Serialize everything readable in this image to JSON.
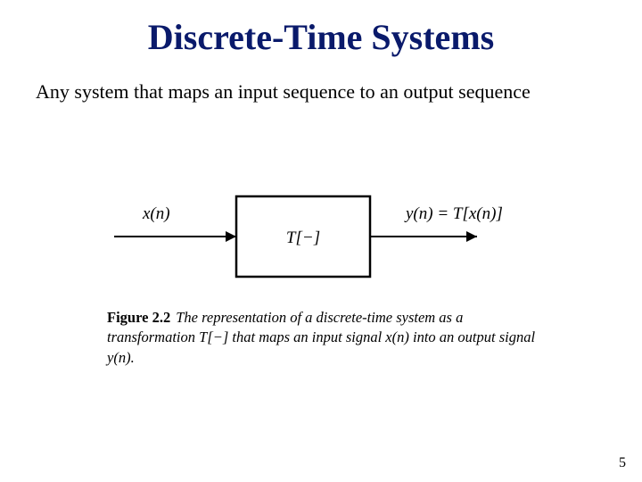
{
  "title": "Discrete-Time Systems",
  "subtitle": "Any system that maps an input sequence to an output sequence",
  "figure": {
    "input_label": "x(n)",
    "block_label": "T[−]",
    "output_label": "y(n) = T[x(n)]",
    "caption_leadin": "Figure 2.2",
    "caption_text": "The representation of a discrete-time system as a transformation T[−] that maps an input signal x(n) into an output signal y(n)."
  },
  "page_number": "5"
}
